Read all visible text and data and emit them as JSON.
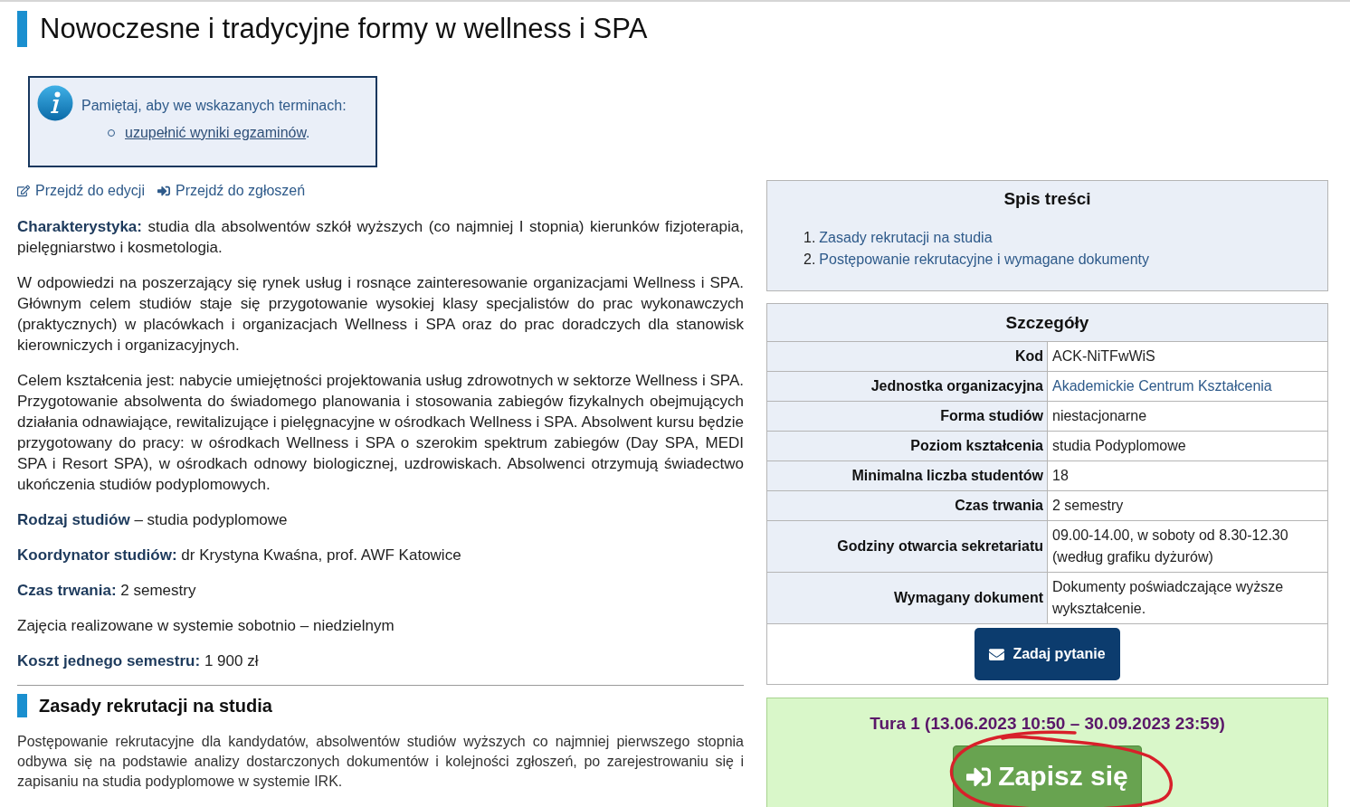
{
  "page_title": "Nowoczesne i tradycyjne formy w wellness i SPA",
  "notice": {
    "text": "Pamiętaj, aby we wskazanych terminach:",
    "items": [
      {
        "link": "uzupełnić wyniki egzaminów",
        "after": "."
      }
    ]
  },
  "actions": [
    {
      "kind": "edit",
      "label": "Przejdź do edycji"
    },
    {
      "kind": "sign_in",
      "label": "Przejdź do zgłoszeń"
    }
  ],
  "description": [
    "**Charakterystyka:** studia dla absolwentów szkół wyższych (co najmniej I stopnia) kierunków fizjoterapia, pielęgniarstwo i kosmetologia.",
    "W odpowiedzi na poszerzający się rynek usług i rosnące zainteresowanie organizacjami Wellness i SPA. Głównym celem studiów staje się przygotowanie wysokiej klasy specjalistów do prac wykonawczych (praktycznych) w placówkach i organizacjach Wellness i SPA oraz do prac doradczych dla stanowisk kierowniczych i organizacyjnych.",
    "Celem kształcenia jest: nabycie umiejętności projektowania usług zdrowotnych w sektorze Wellness i SPA. Przygotowanie absolwenta do świadomego planowania i stosowania zabiegów fizykalnych obejmujących działania odnawiające, rewitalizujące i pielęgnacyjne w ośrodkach Wellness i SPA. Absolwent kursu będzie przygotowany do pracy: w ośrodkach Wellness i SPA o szerokim spektrum zabiegów (Day SPA, MEDI SPA i Resort SPA), w ośrodkach odnowy biologicznej, uzdrowiskach. Absolwenci otrzymują świadectwo ukończenia studiów podyplomowych.",
    "**Rodzaj studiów** – studia podyplomowe",
    "**Koordynator studiów:** dr Krystyna Kwaśna, prof. AWF Katowice",
    "**Czas trwania:** 2 semestry",
    "Zajęcia realizowane w systemie sobotnio – niedzielnym",
    "**Koszt jednego semestru:** 1 900 zł"
  ],
  "section": {
    "heading": "Zasady rekrutacji na studia",
    "text": "Postępowanie rekrutacyjne dla kandydatów, absolwentów studiów wyższych co najmniej pierwszego stopnia odbywa się na podstawie analizy dostarczonych dokumentów i kolejności zgłoszeń, po zarejestrowaniu się i zapisaniu na studia podyplomowe w systemie IRK."
  },
  "toc": {
    "title": "Spis treści",
    "items": [
      {
        "number": "1.",
        "label": "Zasady rekrutacji na studia"
      },
      {
        "number": "2.",
        "label": "Postępowanie rekrutacyjne i wymagane dokumenty"
      }
    ]
  },
  "details": {
    "title": "Szczegóły",
    "rows": [
      {
        "label": "Kod",
        "value": "ACK-NiTFwWiS",
        "kind": "text"
      },
      {
        "label": "Jednostka organizacyjna",
        "value": "Akademickie Centrum Kształcenia",
        "kind": "link"
      },
      {
        "label": "Forma studiów",
        "value": "niestacjonarne",
        "kind": "text"
      },
      {
        "label": "Poziom kształcenia",
        "value": "studia Podyplomowe",
        "kind": "text"
      },
      {
        "label": "Minimalna liczba studentów",
        "value": "18",
        "kind": "text"
      },
      {
        "label": "Czas trwania",
        "value": "2 semestry",
        "kind": "text"
      },
      {
        "label": "Godziny otwarcia sekretariatu",
        "value": "09.00-14.00, w soboty od 8.30-12.30 (według grafiku dyżurów)",
        "kind": "text"
      },
      {
        "label": "Wymagany dokument",
        "value": "Dokumenty poświadczające wyższe wykształcenie.",
        "kind": "text"
      }
    ],
    "button": "Zadaj pytanie"
  },
  "enrollment": {
    "round": "Tura 1 (13.06.2023 10:50 – 30.09.2023 23:59)",
    "button": "Zapisz się"
  }
}
